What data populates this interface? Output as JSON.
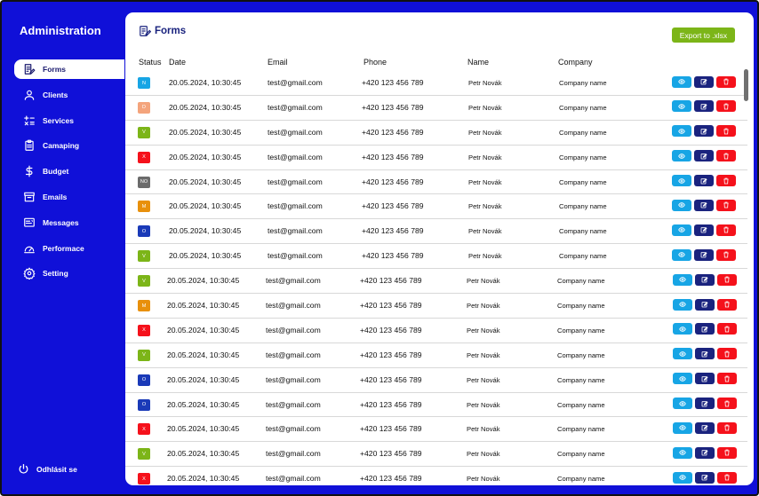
{
  "sidebar": {
    "brand": "Administration",
    "items": [
      {
        "label": "Forms",
        "icon": "forms-icon",
        "active": true
      },
      {
        "label": "Clients",
        "icon": "user-icon",
        "active": false
      },
      {
        "label": "Services",
        "icon": "calculator-icon",
        "active": false
      },
      {
        "label": "Camaping",
        "icon": "clipboard-icon",
        "active": false
      },
      {
        "label": "Budget",
        "icon": "dollar-icon",
        "active": false
      },
      {
        "label": "Emails",
        "icon": "inbox-icon",
        "active": false
      },
      {
        "label": "Messages",
        "icon": "messages-icon",
        "active": false
      },
      {
        "label": "Performace",
        "icon": "gauge-icon",
        "active": false
      },
      {
        "label": "Setting",
        "icon": "gear-icon",
        "active": false
      }
    ],
    "logout": "Odhlásit se"
  },
  "main": {
    "title": "Forms",
    "export_label": "Export to .xlsx",
    "columns": [
      "Status",
      "Date",
      "Email",
      "Phone",
      "Name",
      "Company"
    ],
    "rows": [
      {
        "status": "N",
        "color": "#17a5e5",
        "date": "20.05.2024, 10:30:45",
        "email": "test@gmail.com",
        "phone": "+420 123 456 789",
        "name": "Petr Novák",
        "company": "Company name"
      },
      {
        "status": "D",
        "color": "#f4a47c",
        "date": "20.05.2024, 10:30:45",
        "email": "test@gmail.com",
        "phone": "+420 123 456 789",
        "name": "Petr Novák",
        "company": "Company name"
      },
      {
        "status": "V",
        "color": "#7cb518",
        "date": "20.05.2024, 10:30:45",
        "email": "test@gmail.com",
        "phone": "+420 123 456 789",
        "name": "Petr Novák",
        "company": "Company name"
      },
      {
        "status": "X",
        "color": "#f5111b",
        "date": "20.05.2024, 10:30:45",
        "email": "test@gmail.com",
        "phone": "+420 123 456 789",
        "name": "Petr Novák",
        "company": "Company name"
      },
      {
        "status": "NO",
        "color": "#6b6b6b",
        "date": "20.05.2024, 10:30:45",
        "email": "test@gmail.com",
        "phone": "+420 123 456 789",
        "name": "Petr Novák",
        "company": "Company name"
      },
      {
        "status": "M",
        "color": "#e8900c",
        "date": "20.05.2024, 10:30:45",
        "email": "test@gmail.com",
        "phone": "+420 123 456 789",
        "name": "Petr Novák",
        "company": "Company name"
      },
      {
        "status": "O",
        "color": "#1a3ab8",
        "date": "20.05.2024, 10:30:45",
        "email": "test@gmail.com",
        "phone": "+420 123 456 789",
        "name": "Petr Novák",
        "company": "Company name"
      },
      {
        "status": "V",
        "color": "#7cb518",
        "date": "20.05.2024, 10:30:45",
        "email": "test@gmail.com",
        "phone": "+420 123 456 789",
        "name": "Petr Novák",
        "company": "Company name"
      },
      {
        "status": "V",
        "color": "#7cb518",
        "date": "20.05.2024, 10:30:45",
        "email": "test@gmail.com",
        "phone": "+420 123 456 789",
        "name": "Petr Novák",
        "company": "Company name"
      },
      {
        "status": "M",
        "color": "#e8900c",
        "date": "20.05.2024, 10:30:45",
        "email": "test@gmail.com",
        "phone": "+420 123 456 789",
        "name": "Petr Novák",
        "company": "Company name"
      },
      {
        "status": "X",
        "color": "#f5111b",
        "date": "20.05.2024, 10:30:45",
        "email": "test@gmail.com",
        "phone": "+420 123 456 789",
        "name": "Petr Novák",
        "company": "Company name"
      },
      {
        "status": "V",
        "color": "#7cb518",
        "date": "20.05.2024, 10:30:45",
        "email": "test@gmail.com",
        "phone": "+420 123 456 789",
        "name": "Petr Novák",
        "company": "Company name"
      },
      {
        "status": "O",
        "color": "#1a3ab8",
        "date": "20.05.2024, 10:30:45",
        "email": "test@gmail.com",
        "phone": "+420 123 456 789",
        "name": "Petr Novák",
        "company": "Company name"
      },
      {
        "status": "O",
        "color": "#1a3ab8",
        "date": "20.05.2024, 10:30:45",
        "email": "test@gmail.com",
        "phone": "+420 123 456 789",
        "name": "Petr Novák",
        "company": "Company name"
      },
      {
        "status": "X",
        "color": "#f5111b",
        "date": "20.05.2024, 10:30:45",
        "email": "test@gmail.com",
        "phone": "+420 123 456 789",
        "name": "Petr Novák",
        "company": "Company name"
      },
      {
        "status": "V",
        "color": "#7cb518",
        "date": "20.05.2024, 10:30:45",
        "email": "test@gmail.com",
        "phone": "+420 123 456 789",
        "name": "Petr Novák",
        "company": "Company name"
      },
      {
        "status": "X",
        "color": "#f5111b",
        "date": "20.05.2024, 10:30:45",
        "email": "test@gmail.com",
        "phone": "+420 123 456 789",
        "name": "Petr Novák",
        "company": "Company name"
      }
    ],
    "actions": {
      "view_icon": "eye-icon",
      "edit_icon": "edit-icon",
      "delete_icon": "trash-icon"
    }
  },
  "colors": {
    "sidebar_bg": "#1010d8",
    "accent": "#1a237e",
    "export": "#7cb518",
    "view": "#17a5e5",
    "edit": "#1a237e",
    "delete": "#f5111b"
  }
}
